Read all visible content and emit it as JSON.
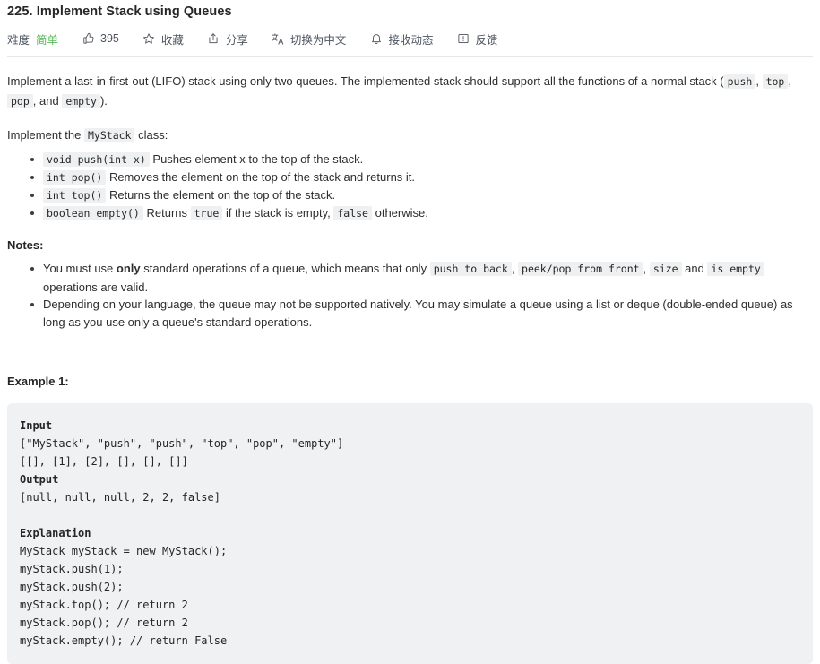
{
  "header": {
    "title": "225. Implement Stack using Queues",
    "difficulty_label": "难度",
    "difficulty_value": "简单",
    "difficulty_color": "#5cb85c",
    "likes": "395",
    "favorite": "收藏",
    "share": "分享",
    "translate": "切换为中文",
    "subscribe": "接收动态",
    "feedback": "反馈"
  },
  "description": {
    "p1_a": "Implement a last-in-first-out (LIFO) stack using only two queues. The implemented stack should support all the functions of a normal stack (",
    "p1_code1": "push",
    "p1_b": ", ",
    "p1_code2": "top",
    "p1_c": ", ",
    "p1_code3": "pop",
    "p1_d": ", and ",
    "p1_code4": "empty",
    "p1_e": ").",
    "p2_a": "Implement the ",
    "p2_code": "MyStack",
    "p2_b": " class:",
    "methods": [
      {
        "code": "void push(int x)",
        "text": "Pushes element x to the top of the stack."
      },
      {
        "code": "int pop()",
        "text": "Removes the element on the top of the stack and returns it."
      },
      {
        "code": "int top()",
        "text": "Returns the element on the top of the stack."
      },
      {
        "code": "boolean empty()",
        "text_a": "Returns ",
        "code_true": "true",
        "text_b": " if the stack is empty, ",
        "code_false": "false",
        "text_c": " otherwise."
      }
    ]
  },
  "notes": {
    "heading": "Notes:",
    "note1_a": "You must use ",
    "note1_bold": "only",
    "note1_b": " standard operations of a queue, which means that only ",
    "note1_code1": "push to back",
    "note1_c": ", ",
    "note1_code2": "peek/pop from front",
    "note1_d": ", ",
    "note1_code3": "size",
    "note1_e": " and ",
    "note1_code4": "is empty",
    "note1_f": " operations are valid.",
    "note2": "Depending on your language, the queue may not be supported natively. You may simulate a queue using a list or deque (double-ended queue) as long as you use only a queue's standard operations."
  },
  "example": {
    "heading": "Example 1:",
    "input_label": "Input",
    "input_line1": "[\"MyStack\", \"push\", \"push\", \"top\", \"pop\", \"empty\"]",
    "input_line2": "[[], [1], [2], [], [], []]",
    "output_label": "Output",
    "output_line": "[null, null, null, 2, 2, false]",
    "explanation_label": "Explanation",
    "explanation_lines": [
      "MyStack myStack = new MyStack();",
      "myStack.push(1);",
      "myStack.push(2);",
      "myStack.top(); // return 2",
      "myStack.pop(); // return 2",
      "myStack.empty(); // return False"
    ]
  }
}
